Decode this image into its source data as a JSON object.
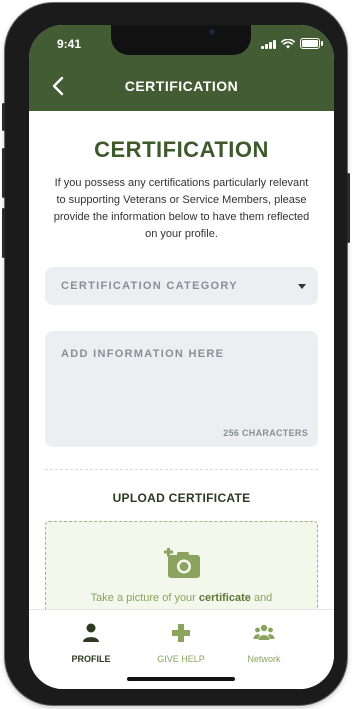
{
  "status_bar": {
    "time": "9:41"
  },
  "nav": {
    "title": "CERTIFICATION"
  },
  "page": {
    "heading": "CERTIFICATION",
    "intro": "If you possess any certifications particularly relevant to supporting Veterans or Service Members, please provide the information below to have them reflected on your profile."
  },
  "form": {
    "category_label": "CERTIFICATION CATEGORY",
    "info_placeholder": "ADD INFORMATION HERE",
    "char_count": "256 CHARACTERS"
  },
  "upload": {
    "title": "UPLOAD CERTIFICATE",
    "text_prefix": "Take a picture of your ",
    "text_bold": "certificate",
    "text_suffix": " and"
  },
  "tabs": [
    {
      "label": "PROFILE",
      "icon": "person-icon",
      "active": true
    },
    {
      "label": "GIVE HELP",
      "icon": "plus-icon",
      "active": false
    },
    {
      "label": "Network",
      "icon": "group-icon",
      "active": false
    }
  ],
  "colors": {
    "header_green": "#445c33",
    "heading_green": "#3e5a2c",
    "upload_accent": "#8aa45f",
    "tab_active": "#2d3a22",
    "tab_inactive": "#8aa45f"
  }
}
